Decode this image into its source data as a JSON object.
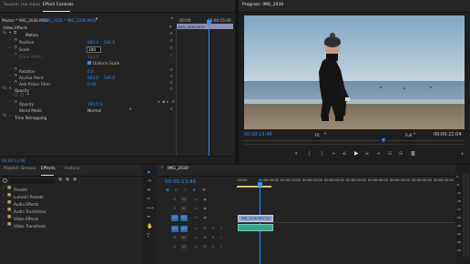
{
  "top_tabs": {
    "source": "Source: (no clips)",
    "effect_controls": "Effect Controls"
  },
  "effect_controls": {
    "master": "Master * IMG_2030.MOV",
    "clip": "IMG_2030 * IMG_2030.MOV",
    "time_start": ";00:00",
    "time_mid": "00:00:15:00",
    "clip_bar_label": "IMG_2030.MOV",
    "section_video_effects": "Video Effects",
    "motion": "Motion",
    "position": {
      "label": "Position",
      "x": "960.0",
      "y": "540.0"
    },
    "scale": {
      "label": "Scale",
      "value": "100"
    },
    "scale_width": {
      "label": "Scale Width",
      "value": "100.0"
    },
    "uniform_scale": "Uniform Scale",
    "rotation": {
      "label": "Rotation",
      "value": "0.0"
    },
    "anchor_point": {
      "label": "Anchor Point",
      "x": "960.0",
      "y": "540.0"
    },
    "anti_flicker": {
      "label": "Anti-flicker Filter",
      "value": "0.00"
    },
    "opacity": "Opacity",
    "opacity_value": {
      "label": "Opacity",
      "value": "100.0 %"
    },
    "blend_mode": {
      "label": "Blend Mode",
      "value": "Normal"
    },
    "time_remapping": "Time Remapping",
    "timecode": "00:00:13:48"
  },
  "program_monitor": {
    "title": "Program: IMG_2030",
    "timecode": "00:00:13:48",
    "fit": "Fit",
    "quality": "Full",
    "duration": "00:00:22:04"
  },
  "project_panel": {
    "tabs": [
      "Project: Greece",
      "Effects",
      "History"
    ],
    "items": [
      "Presets",
      "Lumetri Presets",
      "Audio Effects",
      "Audio Transitions",
      "Video Effects",
      "Video Transitions"
    ]
  },
  "timeline": {
    "sequence_name": "IMG_2030",
    "timecode": "00:00:13:48",
    "ruler": [
      ":00:00",
      "00:00:05:00",
      "00:00:10:00",
      "00:00:15:00",
      "00:00:20:00",
      "00:00:25:00",
      "00:00:30:00",
      "00:00:35:00",
      "00:00:40:00",
      "00:00:45:00"
    ],
    "tracks": [
      "V3",
      "V2",
      "V1",
      "A1",
      "A2",
      "A3"
    ],
    "clip_video": "IMG_2030.MOV [V]",
    "clip_audio": ""
  },
  "meter": {
    "labels": [
      "0",
      "-6",
      "-12",
      "-18",
      "-24",
      "-30",
      "-36",
      "-42",
      "-48",
      "-54"
    ]
  },
  "colors": {
    "accent": "#2e8ff7",
    "clip_video": "#8fa6d9",
    "clip_audio": "#3fa08a",
    "track_on": "#2b6bb7"
  }
}
